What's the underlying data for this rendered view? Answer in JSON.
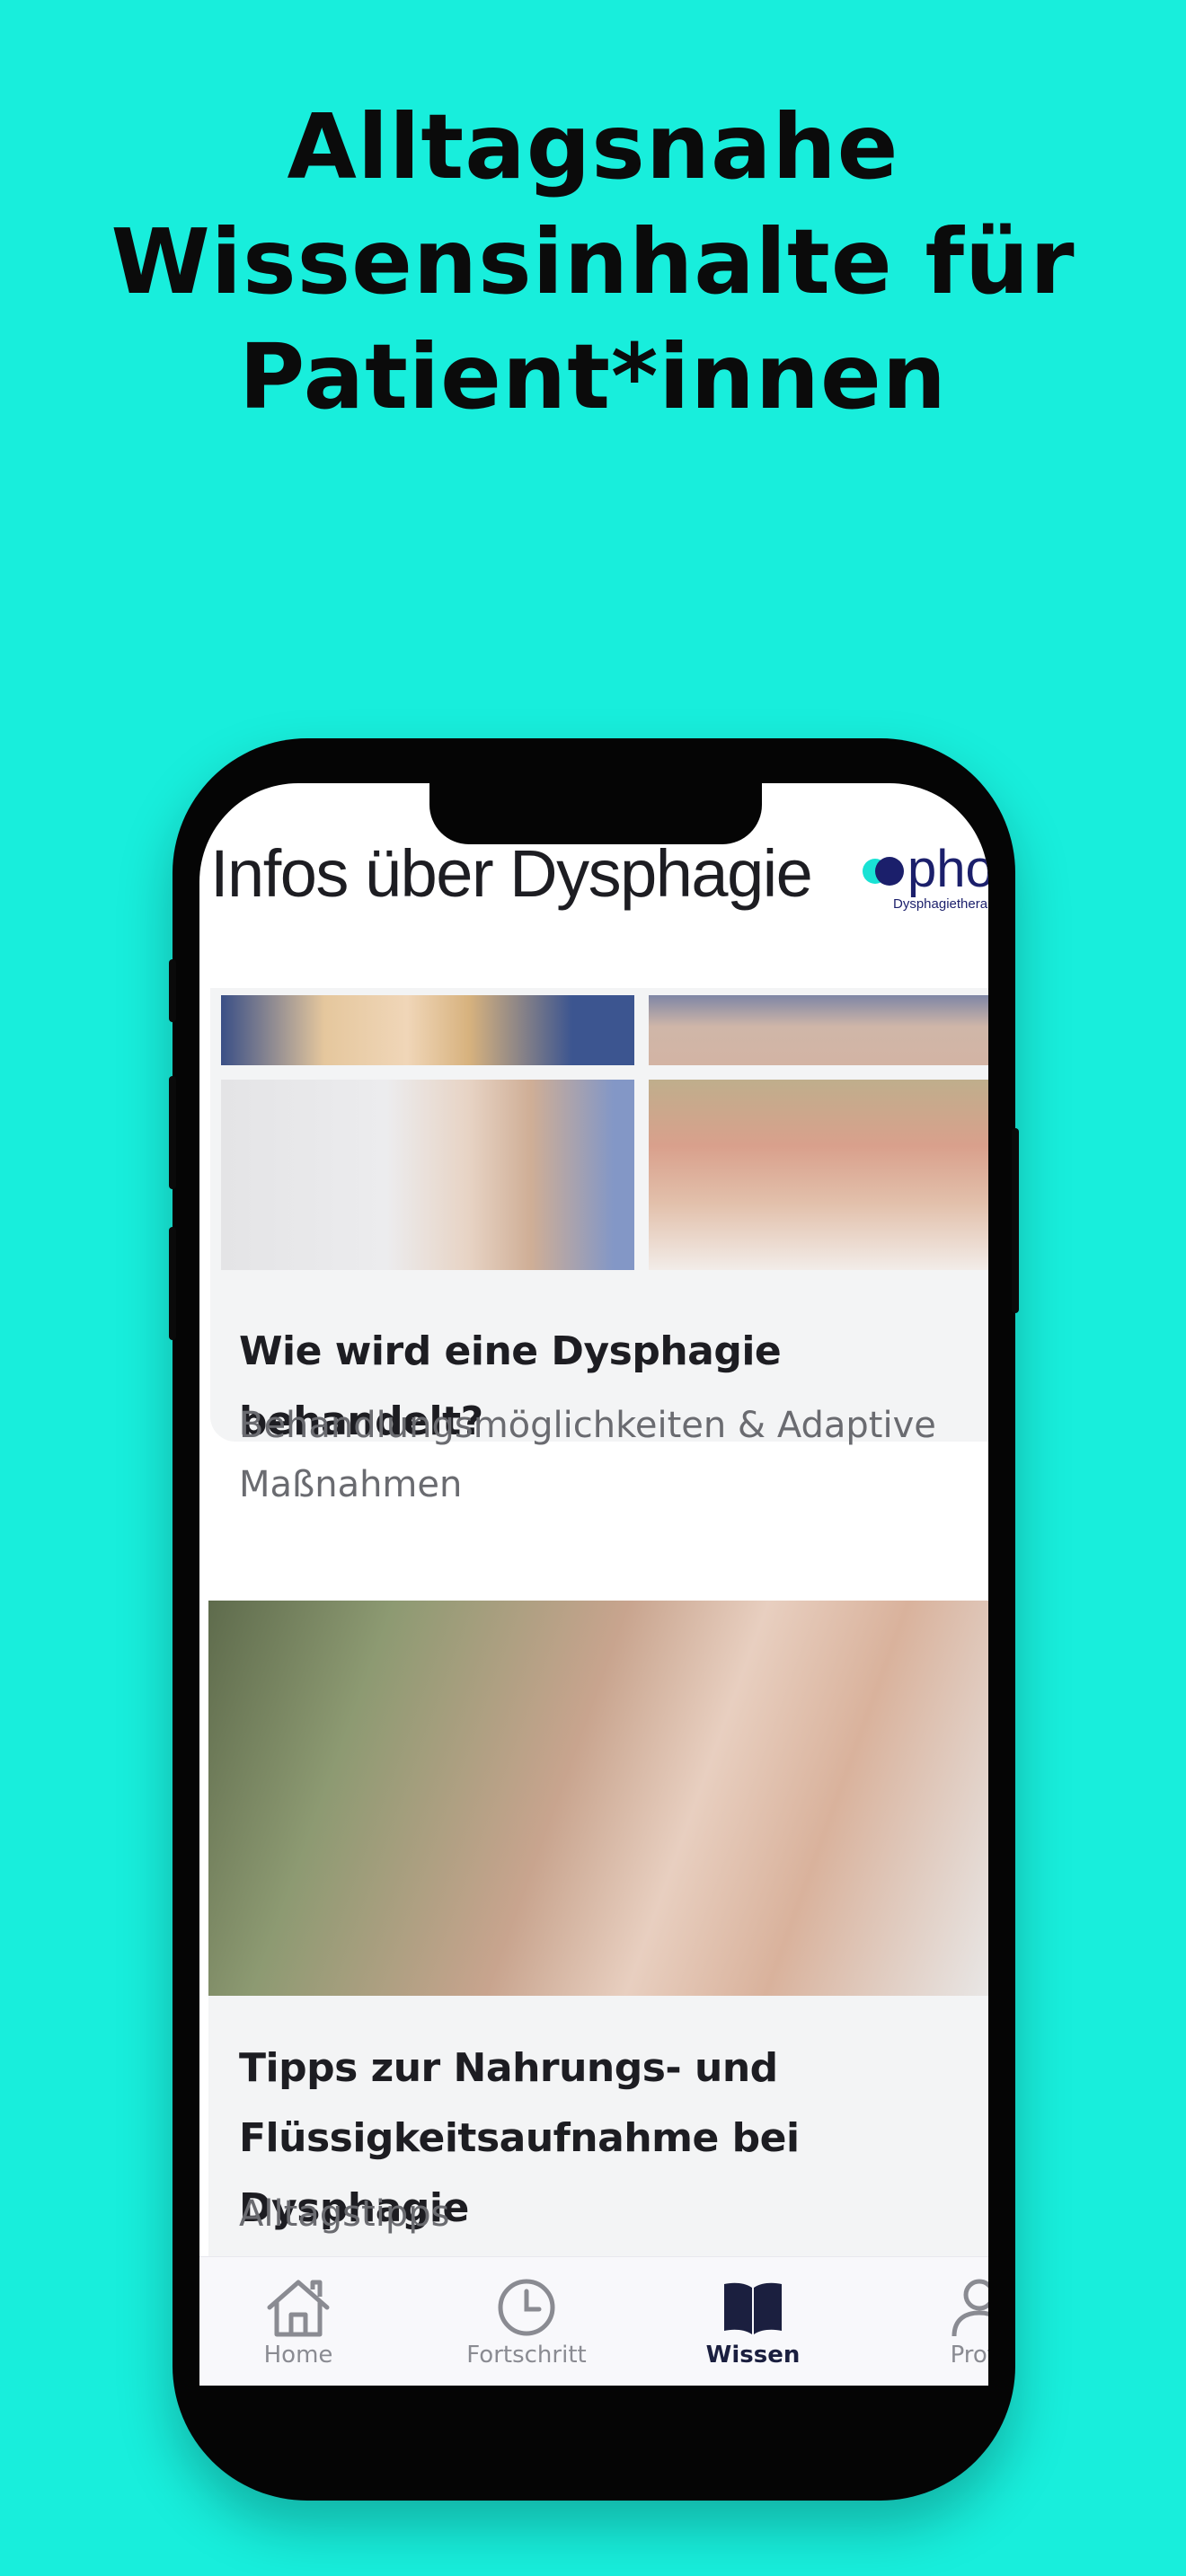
{
  "headline": [
    "Alltagsnahe",
    "Wissensinhalte für",
    "Patient*innen"
  ],
  "app": {
    "title": "Infos über Dysphagie",
    "logo_text": "pho",
    "logo_subtitle": "Dysphagietherapie"
  },
  "articles": [
    {
      "title": "Wie wird eine Dysphagie behandelt?",
      "subtitle": "Behandlungsmöglichkeiten & Adaptive Maßnahmen"
    },
    {
      "title_lines": [
        "Tipps zur Nahrungs- und",
        "Flüssigkeitsaufnahme bei Dysphagie"
      ],
      "subtitle": "Alltagstipps"
    }
  ],
  "tabs": [
    {
      "label": "Home",
      "icon": "home-icon"
    },
    {
      "label": "Fortschritt",
      "icon": "clock-icon"
    },
    {
      "label": "Wissen",
      "icon": "book-icon",
      "active": true
    },
    {
      "label": "Profil",
      "icon": "user-icon"
    }
  ],
  "colors": {
    "background": "#18EEDC",
    "brand": "#1B1F6B",
    "active_tab": "#1B1F3F"
  }
}
